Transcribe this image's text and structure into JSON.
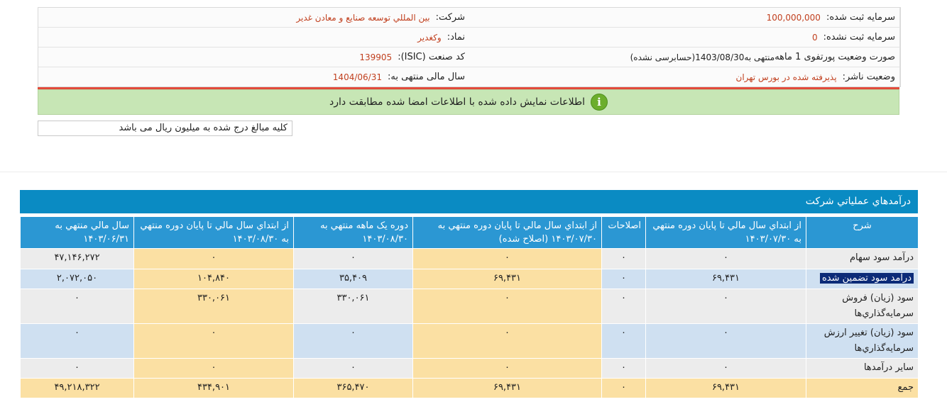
{
  "company": {
    "company_label": "شرکت:",
    "company_value": "بين المللي توسعه صنايع و معادن غدير",
    "symbol_label": "نماد:",
    "symbol_value": "وكغدير",
    "isic_label": "کد صنعت (ISIC):",
    "isic_value": "139905",
    "fiscal_label": "سال مالی منتهی به:",
    "fiscal_value": "1404/06/31",
    "capital_reg_label": "سرمایه ثبت شده:",
    "capital_reg_value": "100,000,000",
    "capital_unreg_label": "سرمایه ثبت نشده:",
    "capital_unreg_value": "0",
    "report_label": "صورت وضعیت پورتفوی 1 ماهه",
    "report_value": "منتهی به1403/08/30(حسابرسی نشده)",
    "publisher_label": "وضعیت ناشر:",
    "publisher_value": "پذیرفته شده در بورس تهران"
  },
  "notice": "اطلاعات نمایش داده شده با اطلاعات امضا شده مطابقت دارد",
  "unit_note": "کلیه مبالغ درج شده به میلیون ریال می باشد",
  "section_title": "درآمدهاي عملياتي شركت",
  "table": {
    "headers": [
      "شرح",
      "از ابتداي سال مالي تا پايان دوره منتهي به ۱۴۰۳/۰۷/۳۰",
      "اصلاحات",
      "از ابتداي سال مالي تا پايان دوره منتهي به ۱۴۰۳/۰۷/۳۰ (اصلاح شده)",
      "دوره یک ماهه منتهي به ۱۴۰۳/۰۸/۳۰",
      "از ابتداي سال مالي تا پايان دوره منتهي به ۱۴۰۳/۰۸/۳۰",
      "سال مالي منتهي به ۱۴۰۳/۰۶/۳۱"
    ],
    "rows": [
      {
        "desc": "درآمد سود سهام",
        "v": [
          "۰",
          "۰",
          "۰",
          "۰",
          "۰",
          "۴۷,۱۴۶,۲۷۲"
        ]
      },
      {
        "desc": "درآمد سود تضمين شده",
        "v": [
          "۶۹,۴۳۱",
          "۰",
          "۶۹,۴۳۱",
          "۳۵,۴۰۹",
          "۱۰۴,۸۴۰",
          "۲,۰۷۲,۰۵۰"
        ]
      },
      {
        "desc": "سود (زيان) فروش سرمايه‌گذاري‌ها",
        "v": [
          "۰",
          "۰",
          "۰",
          "۳۳۰,۰۶۱",
          "۳۳۰,۰۶۱",
          "۰"
        ]
      },
      {
        "desc": "سود (زيان) تغيير ارزش سرمايه‌گذاري‌ها",
        "v": [
          "۰",
          "۰",
          "۰",
          "۰",
          "۰",
          "۰"
        ]
      },
      {
        "desc": "ساير درآمدها",
        "v": [
          "۰",
          "۰",
          "۰",
          "۰",
          "۰",
          "۰"
        ]
      },
      {
        "desc": "جمع",
        "v": [
          "۶۹,۴۳۱",
          "۰",
          "۶۹,۴۳۱",
          "۳۶۵,۴۷۰",
          "۴۳۴,۹۰۱",
          "۴۹,۲۱۸,۳۲۲"
        ]
      }
    ]
  },
  "colors": {
    "header_blue": "#2b97d3",
    "title_blue": "#0a8bc3",
    "highlight_yellow": "#fbe0a3",
    "row_blue": "#cfe0f1",
    "row_gray": "#ececec",
    "notice_green": "#c7e6b5",
    "accent_red": "#c1401f"
  }
}
